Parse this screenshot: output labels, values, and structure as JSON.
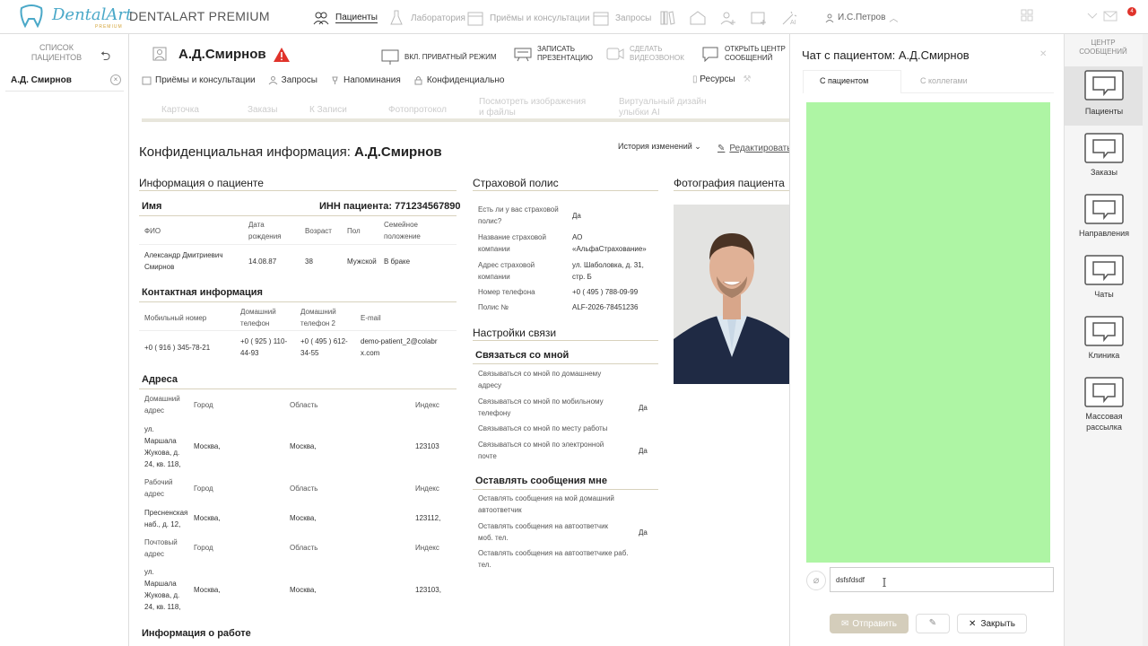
{
  "app": {
    "logo_text": "DentalArt",
    "logo_sub": "PREMIUM",
    "title": "DENTALART PREMIUM"
  },
  "topnav": {
    "patients": "Пациенты",
    "lab": "Лаборатория",
    "appointments": "Приёмы и консультации",
    "requests": "Запросы",
    "user": "И.С.Петров",
    "notif_count": "4"
  },
  "left_panel": {
    "title": "СПИСОК ПАЦИЕНТОВ",
    "patient": "А.Д. Смирнов",
    "close": "×"
  },
  "patient_header": {
    "name": "А.Д.Смирнов",
    "private_mode": "ВКЛ. ПРИВАТНЫЙ РЕЖИМ",
    "record": "ЗАПИСАТЬ ПРЕЗЕНТАЦИЮ",
    "video": "СДЕЛАТЬ ВИДЕОЗВОНОК",
    "open_center": "ОТКРЫТЬ ЦЕНТР СООБЩЕНИЙ",
    "subnav": [
      "Приёмы и консультации",
      "Запросы",
      "Напоминания",
      "Конфиденциально"
    ],
    "resources": "Ресурсы",
    "tabs": [
      "Карточка",
      "Заказы",
      "К Записи",
      "Фотопротокол",
      "Посмотреть изображения и файлы",
      "Виртуальный дизайн улыбки AI"
    ]
  },
  "page": {
    "title_prefix": "Конфиденциальная информация: ",
    "title_name": "А.Д.Смирнов",
    "history": "История изменений",
    "edit": "Редактировать"
  },
  "patient_info": {
    "section": "Информация о пациенте",
    "name_label": "Имя",
    "inn": "ИНН пациента: 771234567890",
    "headers": [
      "ФИО",
      "Дата рождения",
      "Возраст",
      "Пол",
      "Семейное положение"
    ],
    "values": [
      "Александр Дмитриевич Смирнов",
      "14.08.87",
      "38",
      "Мужской",
      "В браке"
    ],
    "contact_title": "Контактная информация",
    "contact_headers": [
      "Мобильный номер",
      "Домашний телефон",
      "Домашний телефон 2",
      "E-mail"
    ],
    "contact_values": [
      "+0 ( 916 ) 345-78-21",
      "+0 ( 925 ) 110-44-93",
      "+0 ( 495 ) 612-34-55",
      "demo-patient_2@colabrx.com"
    ],
    "address_title": "Адреса",
    "addresses": [
      {
        "type": "Домашний адрес",
        "addr": "ул. Маршала Жукова, д. 24, кв. 118,",
        "city": "Москва,",
        "region": "Москва,",
        "zip": "123103"
      },
      {
        "type": "Рабочий адрес",
        "addr": "Пресненская наб., д. 12,",
        "city": "Москва,",
        "region": "Москва,",
        "zip": "123112,"
      },
      {
        "type": "Почтовый адрес",
        "addr": "ул. Маршала Жукова, д. 24, кв. 118,",
        "city": "Москва,",
        "region": "Москва,",
        "zip": "123103,"
      }
    ],
    "addr_headers": [
      "Город",
      "Область",
      "Индекс"
    ],
    "work_title": "Информация о работе"
  },
  "insurance": {
    "section": "Страховой полис",
    "rows": [
      {
        "label": "Есть ли у вас страховой полис?",
        "value": "Да"
      },
      {
        "label": "Название страховой компании",
        "value": "АО «АльфаСтрахование»"
      },
      {
        "label": "Адрес страховой компании",
        "value": "ул. Шаболовка, д. 31, стр. Б"
      },
      {
        "label": "Номер телефона",
        "value": "+0 ( 495 ) 788-09-99"
      },
      {
        "label": "Полис №",
        "value": "ALF-2026-78451236"
      }
    ],
    "comm_title": "Настройки связи",
    "contact_me": "Связаться со мной",
    "contact_rows": [
      {
        "label": "Связываться со мной по домашнему адресу",
        "value": ""
      },
      {
        "label": "Связываться со мной по мобильному телефону",
        "value": "Да"
      },
      {
        "label": "Связываться со мной по месту работы",
        "value": ""
      },
      {
        "label": "Связываться со мной по электронной почте",
        "value": "Да"
      }
    ],
    "leave_title": "Оставлять сообщения мне",
    "leave_rows": [
      {
        "label": "Оставлять сообщения на мой домашний автоответчик",
        "value": ""
      },
      {
        "label": "Оставлять сообщения на автоответчик моб. тел.",
        "value": "Да"
      },
      {
        "label": "Оставлять сообщения на автоответчике раб. тел.",
        "value": ""
      }
    ]
  },
  "photo": {
    "title": "Фотография пациента"
  },
  "chat": {
    "title_prefix": "Чат с пациентом: ",
    "title_name": "А.Д.Смирнов",
    "tab_patient": "С пациентом",
    "tab_colleagues": "С коллегами",
    "input_value": "dsfsfdsdf",
    "send": "Отправить",
    "close": "Закрыть"
  },
  "msg_center": {
    "title": "ЦЕНТР СООБЩЕНИЙ",
    "items": [
      "Пациенты",
      "Заказы",
      "Направления",
      "Чаты",
      "Клиника",
      "Массовая рассылка"
    ]
  },
  "colors": {
    "chat_bg": "#aef5a4",
    "accent": "#4aa8c8",
    "warn": "#e0332b"
  }
}
